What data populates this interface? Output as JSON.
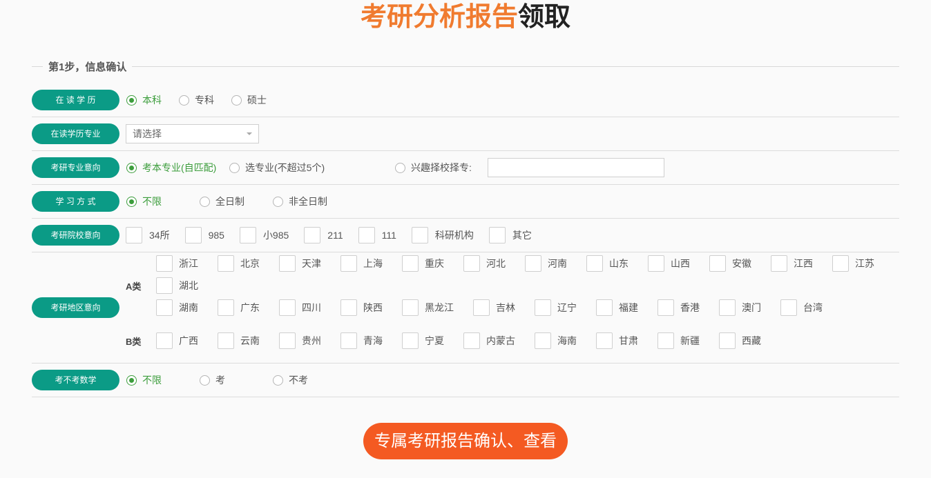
{
  "title": {
    "highlight": "考研分析报告",
    "rest": "领取"
  },
  "colors": {
    "title_highlight": "#f07b2f",
    "label_pill": "#0b9b86",
    "selected": "#3c9d3c",
    "submit_button": "#f45a22"
  },
  "step": {
    "label": "第1步，信息确认"
  },
  "rows": {
    "education": {
      "label": "在 读 学 历",
      "options": [
        "本科",
        "专科",
        "硕士"
      ],
      "selected": "本科"
    },
    "major": {
      "label": "在读学历专业",
      "select_value": "请选择",
      "caret_icon": "chevron-down-icon"
    },
    "intent": {
      "label": "考研专业意向",
      "options": [
        "考本专业(自匹配)",
        "选专业(不超过5个)",
        "兴趣择校择专:"
      ],
      "selected": "考本专业(自匹配)",
      "input_value": ""
    },
    "study_mode": {
      "label": "学 习 方 式",
      "options": [
        "不限",
        "全日制",
        "非全日制"
      ],
      "selected": "不限"
    },
    "schools": {
      "label": "考研院校意向",
      "options": [
        "34所",
        "985",
        "小985",
        "211",
        "111",
        "科研机构",
        "其它"
      ],
      "checked": []
    },
    "regions": {
      "label": "考研地区意向",
      "groups": [
        {
          "label": "A类",
          "lists": [
            [
              "浙江",
              "北京",
              "天津",
              "上海",
              "重庆",
              "河北",
              "河南",
              "山东",
              "山西",
              "安徽",
              "江西",
              "江苏",
              "湖北"
            ],
            [
              "湖南",
              "广东",
              "四川",
              "陕西",
              "黑龙江",
              "吉林",
              "辽宁",
              "福建",
              "香港",
              "澳门",
              "台湾"
            ]
          ]
        },
        {
          "label": "B类",
          "lists": [
            [
              "广西",
              "云南",
              "贵州",
              "青海",
              "宁夏",
              "内蒙古",
              "海南",
              "甘肃",
              "新疆",
              "西藏"
            ]
          ]
        }
      ],
      "checked": []
    },
    "math": {
      "label": "考不考数学",
      "options": [
        "不限",
        "考",
        "不考"
      ],
      "selected": "不限"
    }
  },
  "submit": {
    "label": "专属考研报告确认、查看"
  }
}
